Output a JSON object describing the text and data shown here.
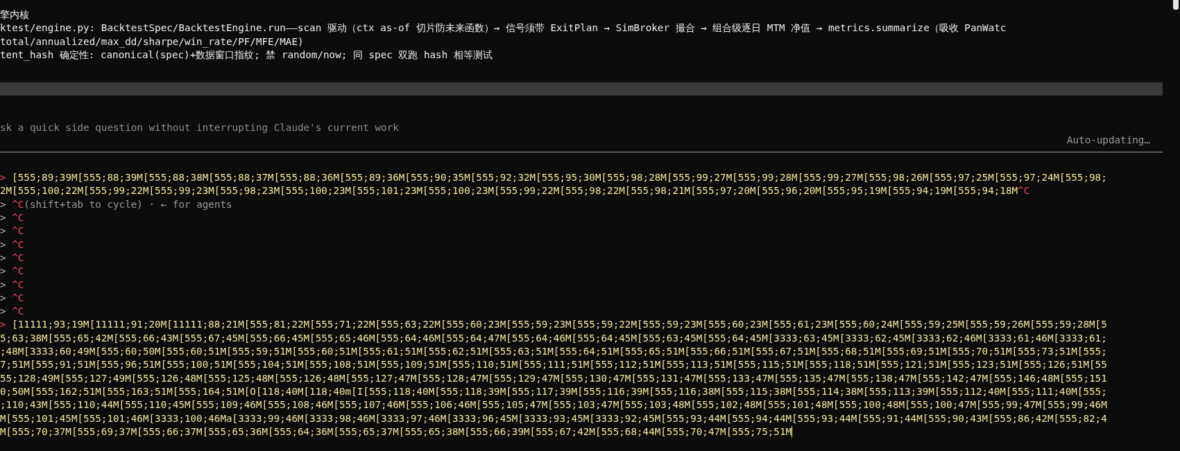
{
  "output": [
    {
      "segments": [
        {
          "kind": "body",
          "text": "擎内核"
        }
      ]
    },
    {
      "segments": [
        {
          "kind": "body",
          "text": "ktest/engine.py: BacktestSpec/BacktestEngine.run——scan 驱动（ctx as-of 切片防未来函数）→ 信号须带 ExitPlan → SimBroker 撮合 → 组合级逐日 MTM 净值 → metrics.summarize（吸收 PanWatc"
        }
      ]
    },
    {
      "segments": [
        {
          "kind": "body",
          "text": "total/annualized/max_dd/sharpe/win_rate/PF/MFE/MAE)"
        }
      ]
    },
    {
      "segments": [
        {
          "kind": "body",
          "text": "tent_hash 确定性: canonical(spec)+数据窗口指纹; 禁 random/now; 同 spec 双跑 hash 相等测试"
        }
      ]
    }
  ],
  "side_question": {
    "placeholder": "sk a quick side question without interrupting Claude's current work",
    "status": "Auto-updating…"
  },
  "transcript": [
    {
      "segments": [
        {
          "kind": "marker",
          "text": "> "
        },
        {
          "kind": "input",
          "text": "[555;89;39M[555;88;39M[555;88;38M[555;88;37M[555;88;36M[555;89;36M[555;90;35M[555;92;32M[555;95;30M[555;98;28M[555;99;27M[555;99;28M[555;99;27M[555;98;26M[555;97;25M[555;97;24M[555;98;"
        }
      ]
    },
    {
      "segments": [
        {
          "kind": "input",
          "text": "2M[555;100;22M[555;99;22M[555;99;23M[555;98;23M[555;100;23M[555;101;23M[555;100;23M[555;99;22M[555;98;22M[555;98;21M[555;97;20M[555;96;20M[555;95;19M[555;94;19M[555;94;18M"
        },
        {
          "kind": "ctrl",
          "text": "^C"
        }
      ]
    },
    {
      "segments": [
        {
          "kind": "marker-dim",
          "text": "> "
        },
        {
          "kind": "ctrl",
          "text": "^C"
        },
        {
          "kind": "hint",
          "text": "(shift+tab to cycle) · ← for agents"
        }
      ]
    },
    {
      "segments": [
        {
          "kind": "marker-dim",
          "text": "> "
        },
        {
          "kind": "ctrl",
          "text": "^C"
        }
      ]
    },
    {
      "segments": [
        {
          "kind": "marker-dim",
          "text": "> "
        },
        {
          "kind": "ctrl",
          "text": "^C"
        }
      ]
    },
    {
      "segments": [
        {
          "kind": "marker-dim",
          "text": "> "
        },
        {
          "kind": "ctrl",
          "text": "^C"
        }
      ]
    },
    {
      "segments": [
        {
          "kind": "marker-dim",
          "text": "> "
        },
        {
          "kind": "ctrl",
          "text": "^C"
        }
      ]
    },
    {
      "segments": [
        {
          "kind": "marker-dim",
          "text": "> "
        },
        {
          "kind": "ctrl",
          "text": "^C"
        }
      ]
    },
    {
      "segments": [
        {
          "kind": "marker-dim",
          "text": "> "
        },
        {
          "kind": "ctrl",
          "text": "^C"
        }
      ]
    },
    {
      "segments": [
        {
          "kind": "marker-dim",
          "text": "> "
        },
        {
          "kind": "ctrl",
          "text": "^C"
        }
      ]
    },
    {
      "segments": [
        {
          "kind": "marker-dim",
          "text": "> "
        },
        {
          "kind": "ctrl",
          "text": "^C"
        }
      ]
    },
    {
      "segments": [
        {
          "kind": "marker",
          "text": "> "
        },
        {
          "kind": "input",
          "text": "[11111;93;19M[11111;91;20M[11111;88;21M[555;81;22M[555;71;22M[555;63;22M[555;60;23M[555;59;23M[555;59;22M[555;59;23M[555;60;23M[555;61;23M[555;60;24M[555;59;25M[555;59;26M[555;59;28M[5"
        }
      ]
    },
    {
      "segments": [
        {
          "kind": "input",
          "text": "5;63;38M[555;65;42M[555;66;43M[555;67;45M[555;66;45M[555;65;46M[555;64;46M[555;64;47M[555;64;46M[555;64;45M[555;63;45M[555;64;45M[3333;63;45M[3333;62;45M[3333;62;46M[3333;61;46M[3333;61;"
        }
      ]
    },
    {
      "segments": [
        {
          "kind": "input",
          "text": ";48M[3333;60;49M[555;60;50M[555;60;51M[555;59;51M[555;60;51M[555;61;51M[555;62;51M[555;63;51M[555;64;51M[555;65;51M[555;66;51M[555;67;51M[555;68;51M[555;69;51M[555;70;51M[555;73;51M[555;"
        }
      ]
    },
    {
      "segments": [
        {
          "kind": "input",
          "text": "7;51M[555;91;51M[555;96;51M[555;100;51M[555;104;51M[555;108;51M[555;109;51M[555;110;51M[555;111;51M[555;112;51M[555;113;51M[555;115;51M[555;118;51M[555;121;51M[555;123;51M[555;126;51M[55"
        }
      ]
    },
    {
      "segments": [
        {
          "kind": "input",
          "text": "55;128;49M[555;127;49M[555;126;48M[555;125;48M[555;126;48M[555;127;47M[555;128;47M[555;129;47M[555;130;47M[555;131;47M[555;133;47M[555;135;47M[555;138;47M[555;142;47M[555;146;48M[555;151"
        }
      ]
    },
    {
      "segments": [
        {
          "kind": "input",
          "text": "0;50M[555;162;51M[555;163;51M[555;164;51M[O[118;40M[118;40m[I[555;118;40M[555;118;39M[555;117;39M[555;116;39M[555;116;38M[555;115;38M[555;114;38M[555;113;39M[555;112;40M[555;111;40M[555;"
        }
      ]
    },
    {
      "segments": [
        {
          "kind": "input",
          "text": ";110;43M[555;110;44M[555;110;45M[555;109;46M[555;108;46M[555;107;46M[555;106;46M[555;105;47M[555;103;47M[555;103;48M[555;102;48M[555;101;48M[555;100;48M[555;100;47M[555;99;47M[555;99;46M"
        }
      ]
    },
    {
      "segments": [
        {
          "kind": "input",
          "text": "M[555;101;45M[555;101;46M[3333;100;46Ma[3333;99;46M[3333;98;46M[3333;97;46M[3333;96;45M[3333;93;45M[3333;92;45M[555;93;44M[555;94;44M[555;93;44M[555;91;44M[555;90;43M[555;86;42M[555;82;4"
        }
      ]
    },
    {
      "segments": [
        {
          "kind": "input",
          "text": "M[555;70;37M[555;69;37M[555;66;37M[555;65;36M[555;64;36M[555;65;37M[555;65;38M[555;66;39M[555;67;42M[555;68;44M[555;70;47M[555;75;51M"
        }
      ],
      "cursor": true
    }
  ]
}
